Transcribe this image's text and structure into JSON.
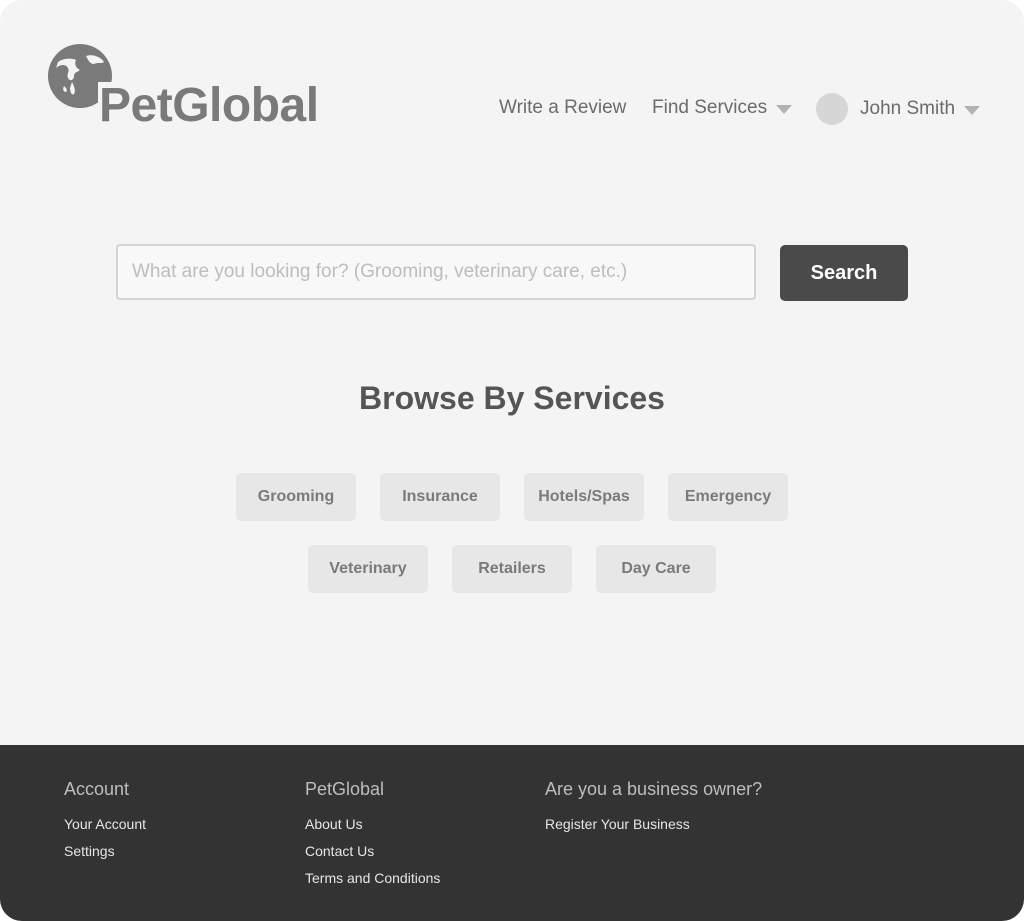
{
  "brand": {
    "name": "PetGlobal",
    "logo_icon": "globe-icon"
  },
  "nav": {
    "write_review": "Write a Review",
    "find_services": "Find Services",
    "user_name": "John Smith"
  },
  "search": {
    "placeholder": "What are you looking for? (Grooming, veterinary care, etc.)",
    "value": "",
    "button_label": "Search"
  },
  "browse": {
    "title": "Browse By Services",
    "services": [
      "Grooming",
      "Insurance",
      "Hotels/Spas",
      "Emergency",
      "Veterinary",
      "Retailers",
      "Day Care"
    ]
  },
  "footer": {
    "account": {
      "heading": "Account",
      "links": [
        "Your Account",
        "Settings"
      ]
    },
    "company": {
      "heading": "PetGlobal",
      "links": [
        "About Us",
        "Contact Us",
        "Terms and Conditions"
      ]
    },
    "business": {
      "heading": "Are you a business owner?",
      "links": [
        "Register Your Business"
      ]
    }
  },
  "colors": {
    "background": "#f4f4f4",
    "footer": "#333333",
    "button": "#4a4a4a",
    "chip": "#e7e7e7",
    "logo": "#7a7a7a"
  }
}
